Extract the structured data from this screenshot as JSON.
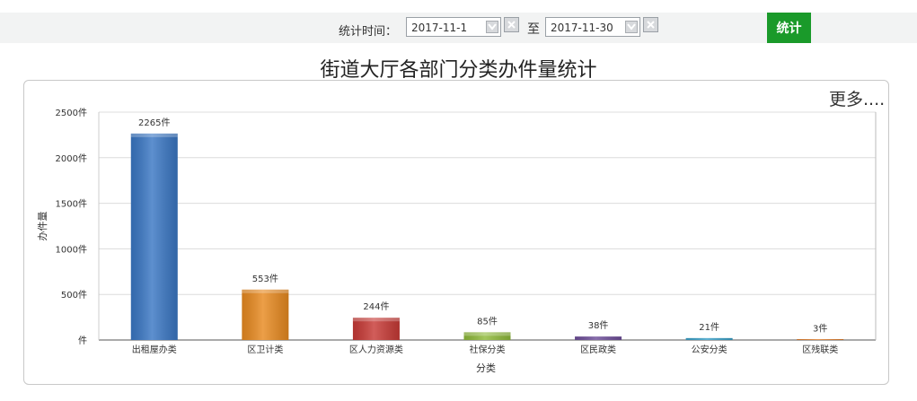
{
  "filter": {
    "label": "统计时间：",
    "start_date": "2017-11-1",
    "to_label": "至",
    "end_date": "2017-11-30",
    "button_label": "统计"
  },
  "title": "街道大厅各部门分类办件量统计",
  "more_label": "更多....",
  "colors": {
    "button": "#1a9a2a",
    "bars": [
      "#3a77c4",
      "#e88a20",
      "#c83a36",
      "#8fba3a",
      "#6f4f9a",
      "#3aa0c8",
      "#e07f30"
    ]
  },
  "chart_data": {
    "type": "bar",
    "xlabel": "分类",
    "ylabel": "办件量",
    "ylim": [
      0,
      2500
    ],
    "yticks": [
      0,
      500,
      1000,
      1500,
      2000,
      2500
    ],
    "ytick_labels": [
      "件",
      "500件",
      "1000件",
      "1500件",
      "2000件",
      "2500件"
    ],
    "categories": [
      "出租屋办类",
      "区卫计类",
      "区人力资源类",
      "社保分类",
      "区民政类",
      "公安分类",
      "区残联类"
    ],
    "values": [
      2265,
      553,
      244,
      85,
      38,
      21,
      3
    ],
    "data_labels": [
      "2265件",
      "553件",
      "244件",
      "85件",
      "38件",
      "21件",
      "3件"
    ],
    "grid": true
  }
}
